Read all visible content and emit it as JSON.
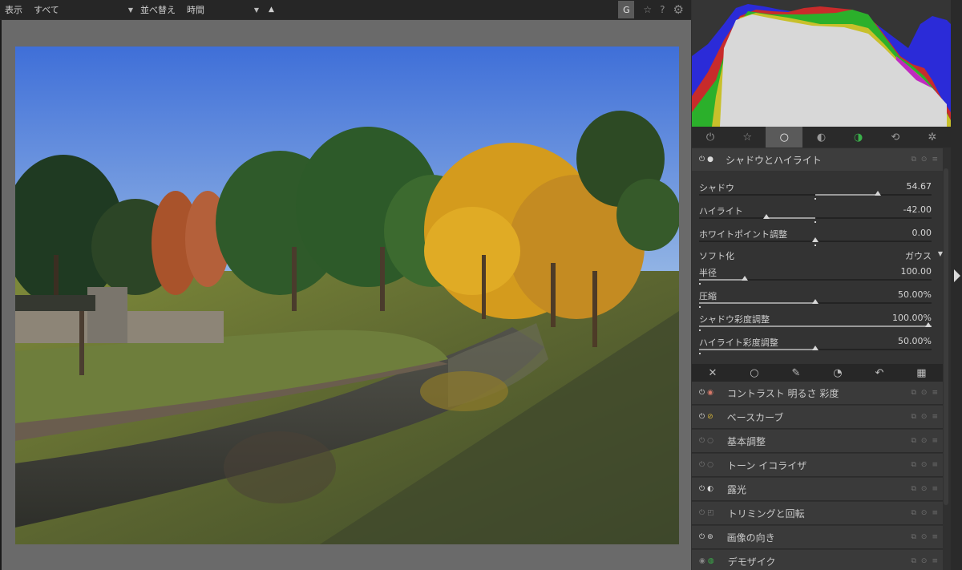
{
  "toolbar": {
    "display_label": "表示",
    "display_value": "すべて",
    "sort_label": "並べ替え",
    "sort_value": "時間",
    "sort_direction_icon": "triangle-up",
    "grouping_button": "G",
    "icons": [
      "star-icon",
      "help-icon",
      "gear-icon"
    ]
  },
  "group_tabs": [
    {
      "name": "power-icon",
      "glyph": "⏻",
      "active": false
    },
    {
      "name": "star-icon",
      "glyph": "☆",
      "active": false
    },
    {
      "name": "circle-icon",
      "glyph": "○",
      "active": true
    },
    {
      "name": "tone-icon",
      "glyph": "◐",
      "active": false
    },
    {
      "name": "color-icon",
      "glyph": "◑",
      "active": false
    },
    {
      "name": "correct-icon",
      "glyph": "⟲",
      "active": false
    },
    {
      "name": "effect-icon",
      "glyph": "✲",
      "active": false
    }
  ],
  "active_module": {
    "title": "シャドウとハイライト",
    "params": [
      {
        "name": "シャドウ",
        "value": "54.67",
        "position": 0.77
      },
      {
        "name": "ハイライト",
        "value": "-42.00",
        "position": 0.29
      },
      {
        "name": "ホワイトポイント調整",
        "value": "0.00",
        "position": 0.5
      },
      {
        "name": "半径",
        "value": "100.00",
        "position": 0.19
      },
      {
        "name": "圧縮",
        "value": "50.00%",
        "position": 0.5
      },
      {
        "name": "シャドウ彩度調整",
        "value": "100.00%",
        "position": 1.0
      },
      {
        "name": "ハイライト彩度調整",
        "value": "50.00%",
        "position": 0.5
      }
    ],
    "softness": {
      "label": "ソフト化",
      "value": "ガウス"
    }
  },
  "blend_icons": [
    "close-icon",
    "circle-icon",
    "brush-icon",
    "parametric-icon",
    "combined-icon",
    "raster-icon"
  ],
  "modules": [
    {
      "title": "コントラスト 明るさ 彩度",
      "enabled": true
    },
    {
      "title": "ベースカーブ",
      "enabled": true
    },
    {
      "title": "基本調整",
      "enabled": false
    },
    {
      "title": "トーン イコライザ",
      "enabled": false
    },
    {
      "title": "露光",
      "enabled": true
    },
    {
      "title": "トリミングと回転",
      "enabled": false
    },
    {
      "title": "画像の向き",
      "enabled": true
    },
    {
      "title": "デモザイク",
      "enabled": true
    }
  ],
  "colors": {
    "accent_active_tab": "#5a5a5a",
    "panel_bg": "#303030"
  }
}
